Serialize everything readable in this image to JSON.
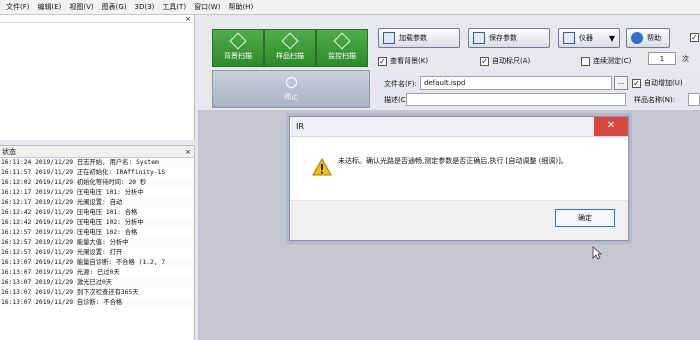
{
  "menu": [
    "文件(F)",
    "编辑(E)",
    "视图(V)",
    "图表(G)",
    "3D(3)",
    "工具(T)",
    "窗口(W)",
    "帮助(H)"
  ],
  "left_top": {
    "hint": "◦",
    "close": "×"
  },
  "status_panel": {
    "title": "状态",
    "close": "×",
    "rows": [
      "16:11:24 2019/11/29 日志开始, 用户名: System",
      "16:11:57 2019/11/29 正在初始化: IRAffinity-1S",
      "16:12:02 2019/11/29 初始化等待时间: 20 秒",
      "16:12:17 2019/11/29 压电电压 101: 分析中",
      "16:12:17 2019/11/29 光阑设置: 自动",
      "16:12:42 2019/11/29 压电电压 101: 合格",
      "16:12:42 2019/11/29 压电电压 102: 分析中",
      "16:12:57 2019/11/29 压电电压 102: 合格",
      "16:12:57 2019/11/29 能量大值: 分析中",
      "16:12:57 2019/11/29 光阑设置: 打开",
      "16:13:07 2019/11/29 能量自诊断: 不合格 (1.2, 7",
      "16:13:07 2019/11/29 光源: 已过0天",
      "16:13:07 2019/11/29 激光已过0天",
      "16:13:07 2019/11/29 到下次检查还有365天",
      "16:13:07 2019/11/29 自诊断: 不合格"
    ]
  },
  "toolbar": {
    "scan_buttons": [
      "背景扫描",
      "样品扫描",
      "监控扫描"
    ],
    "stop": "停止",
    "load_params": "加载参数",
    "save_params": "保存参数",
    "instrument": "仪器",
    "instrument_arrow": "▼",
    "help": "帮助",
    "checkboxes": {
      "view_background": {
        "label": "查看背景(K)",
        "checked": true
      },
      "auto_ruler": {
        "label": "自动标尺(A)",
        "checked": true
      },
      "continuous": {
        "label": "连续测定(C)",
        "checked": false
      },
      "top_right": {
        "label": "",
        "checked": true
      },
      "auto_increment": {
        "label": "自动增加(U)",
        "checked": true
      }
    },
    "check_mark": "✓",
    "count_value": "1",
    "count_unit": "次"
  },
  "form": {
    "file_label": "文件名(F):",
    "file_value": "default.ispd",
    "browse": "...",
    "desc_label": "描述(C):",
    "sample_label": "样品名称(N):"
  },
  "dialog": {
    "title": "IR",
    "close": "✕",
    "message": "未达标。确认光路是否通畅,测定参数是否正确后,执行 [自动调整 (细调)]。",
    "ok": "确定"
  },
  "colors": {
    "green": "#3e9c3a",
    "warning": "#f2c200",
    "close_red": "#d9483e",
    "workspace": "#c3c7d1"
  }
}
